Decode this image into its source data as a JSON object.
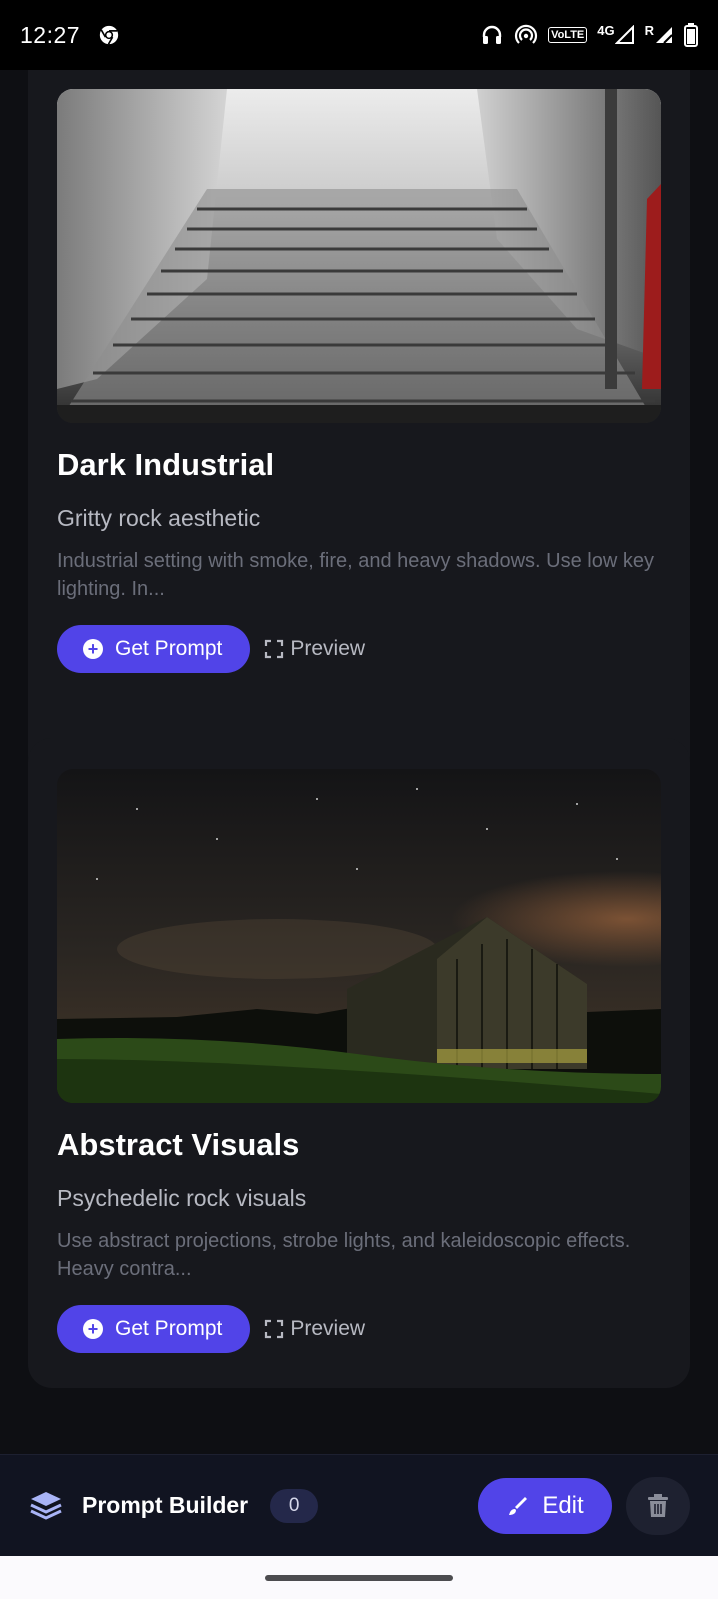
{
  "status_bar": {
    "time": "12:27",
    "volte": "VoLTE",
    "network": "4G",
    "roaming": "R"
  },
  "cards": [
    {
      "image": "foggy-stone-staircase-photo",
      "title": "Dark Industrial",
      "subtitle": "Gritty rock aesthetic",
      "description": "Industrial setting with smoke, fire, and heavy shadows. Use low key lighting. In...",
      "get_prompt_label": "Get Prompt",
      "preview_label": "Preview"
    },
    {
      "image": "night-barn-sky-photo",
      "title": "Abstract Visuals",
      "subtitle": "Psychedelic rock visuals",
      "description": "Use abstract projections, strobe lights, and kaleidoscopic effects. Heavy contra...",
      "get_prompt_label": "Get Prompt",
      "preview_label": "Preview"
    }
  ],
  "bottom_bar": {
    "title": "Prompt Builder",
    "count": "0",
    "edit_label": "Edit"
  },
  "colors": {
    "accent": "#5144e8",
    "card_bg": "#17181d",
    "page_bg": "#0e0f13"
  }
}
